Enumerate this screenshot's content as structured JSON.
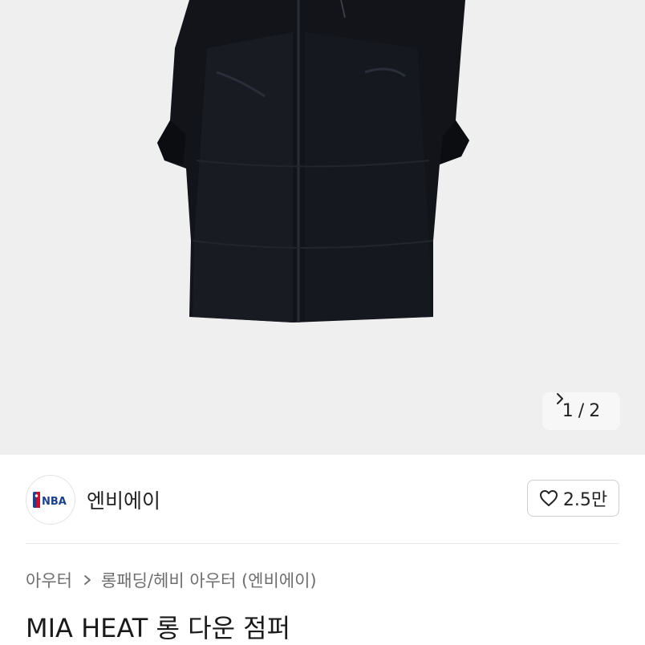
{
  "product_gallery": {
    "image_alt_icon": "long-down-jacket-image",
    "pager": {
      "current": "1",
      "separator": "/",
      "total": "2"
    }
  },
  "brand": {
    "logo_text": "NBA",
    "name": "엔비에이",
    "likes": "2.5만"
  },
  "breadcrumb": {
    "level1": "아우터",
    "level2": "롱패딩/헤비 아우터 (엔비에이)"
  },
  "product": {
    "title": "MIA HEAT 롱 다운 점퍼"
  },
  "colors": {
    "gallery_bg": "#efefef",
    "nba_blue": "#1d428a",
    "nba_red": "#c8102e",
    "jacket": "#111318"
  }
}
